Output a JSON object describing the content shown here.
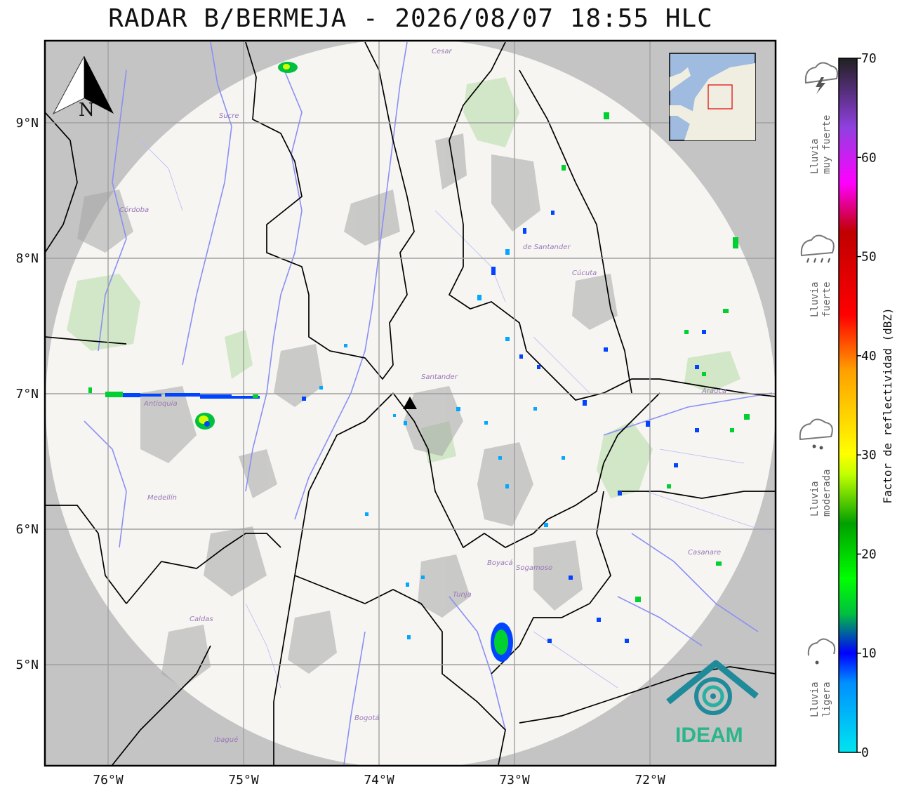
{
  "title": "RADAR B/BERMEJA - 2026/08/07 18:55 HLC",
  "map": {
    "lon_ticks": [
      "76°W",
      "75°W",
      "74°W",
      "73°W",
      "72°W"
    ],
    "lat_ticks": [
      "9°N",
      "8°N",
      "7°N",
      "6°N",
      "5°N"
    ],
    "north_arrow": "N",
    "logo_text": "IDEAM",
    "place_labels": [
      "Cesar",
      "Sucre",
      "Córdoba",
      "Antioquia",
      "Medellín",
      "Caldas",
      "Boyacá",
      "Casanare",
      "Arauca",
      "Santander",
      "Cúcuta",
      "de Santander",
      "Bogotá",
      "Ibagué",
      "Sogamoso",
      "Tunja"
    ]
  },
  "colorbar": {
    "title": "Factor de reflectividad (dBZ)",
    "ticks": [
      "0",
      "10",
      "20",
      "30",
      "40",
      "50",
      "60",
      "70"
    ],
    "range": [
      0,
      70
    ]
  },
  "rain_legend": [
    {
      "label_1": "Lluvia",
      "label_2": "muy fuerte",
      "icon": "thunderstorm-cloud-icon"
    },
    {
      "label_1": "Lluvia",
      "label_2": "fuerte",
      "icon": "heavy-rain-cloud-icon"
    },
    {
      "label_1": "Lluvia",
      "label_2": "moderada",
      "icon": "moderate-rain-cloud-icon"
    },
    {
      "label_1": "Lluvia",
      "label_2": "ligera",
      "icon": "light-rain-cloud-icon"
    }
  ],
  "colors": {
    "outside_coverage": "#c4c4c4",
    "inside_coverage": "#f6f5f2",
    "rivers": "#8a8ff5",
    "borders": "#000000",
    "parks": "#cde6c2",
    "logo": "#1f8a9a"
  }
}
